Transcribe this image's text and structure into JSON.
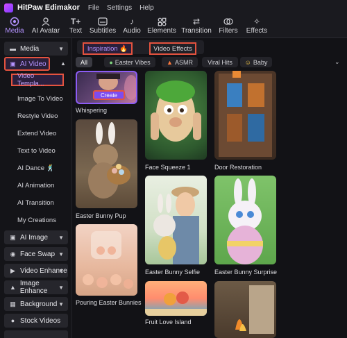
{
  "app": {
    "title": "HitPaw Edimakor",
    "menu": [
      "File",
      "Settings",
      "Help"
    ]
  },
  "toolbar": [
    {
      "label": "Media",
      "icon": "media-icon",
      "active": true
    },
    {
      "label": "AI Avatar",
      "icon": "ai-avatar-icon"
    },
    {
      "label": "Text",
      "icon": "text-icon"
    },
    {
      "label": "Subtitles",
      "icon": "subtitles-icon"
    },
    {
      "label": "Audio",
      "icon": "audio-icon"
    },
    {
      "label": "Elements",
      "icon": "elements-icon"
    },
    {
      "label": "Transition",
      "icon": "transition-icon"
    },
    {
      "label": "Filters",
      "icon": "filters-icon"
    },
    {
      "label": "Effects",
      "icon": "effects-icon"
    }
  ],
  "sidebar": {
    "media": "Media",
    "ai_video": "AI Video",
    "ai_video_items": [
      "Video Templa...",
      "Image To Video",
      "Restyle Video",
      "Extend Video",
      "Text to Video",
      "AI Dance 🕺",
      "AI Animation",
      "AI Transition",
      "My Creations"
    ],
    "sections": [
      "AI Image",
      "Face Swap",
      "Video Enhance",
      "Image Enhance",
      "Background",
      "Stock Videos"
    ]
  },
  "tabs": {
    "inspiration": "Inspiration 🔥",
    "video_effects": "Video Effects"
  },
  "chips": [
    {
      "label": "All",
      "selected": true
    },
    {
      "label": "Easter Vibes",
      "icon": "easter-egg-icon"
    },
    {
      "label": "ASMR",
      "icon": "flame-icon"
    },
    {
      "label": "Viral Hits",
      "icon": "viral-icon"
    },
    {
      "label": "Baby",
      "icon": "baby-icon"
    }
  ],
  "templates": {
    "whispering": "Whispering",
    "create": "Create",
    "face_squeeze": "Face Squeeze 1",
    "door_restoration": "Door Restoration",
    "easter_bunny_pup": "Easter Bunny Pup",
    "easter_bunny_selfie": "Easter Bunny Selfie",
    "easter_bunny_surprise": "Easter Bunny Surprise",
    "pouring_easter_bunnies": "Pouring Easter Bunnies",
    "fruit_love_island": "Fruit Love Island"
  },
  "colors": {
    "accent": "#b493ff",
    "highlight_border": "#e5533f",
    "background": "#121216"
  }
}
